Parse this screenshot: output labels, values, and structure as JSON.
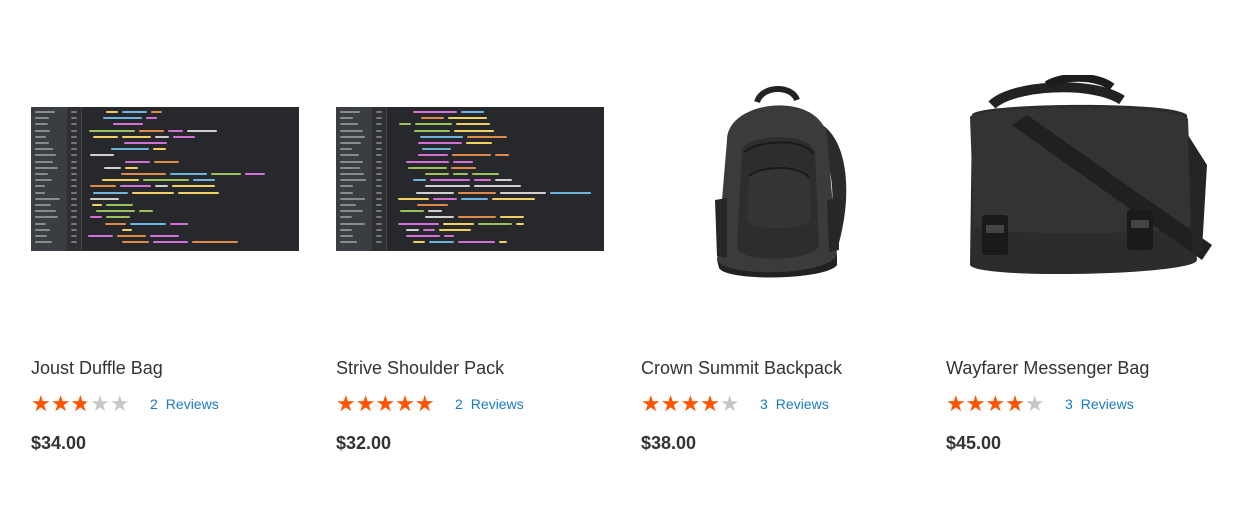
{
  "products": [
    {
      "name": "Joust Duffle Bag",
      "image": "code-editor-screenshot",
      "rating_fraction": 0.5,
      "reviews_count": "2",
      "reviews_label": "Reviews",
      "price": "$34.00"
    },
    {
      "name": "Strive Shoulder Pack",
      "image": "code-editor-screenshot",
      "rating_fraction": 0.9,
      "reviews_count": "2",
      "reviews_label": "Reviews",
      "price": "$32.00"
    },
    {
      "name": "Crown Summit Backpack",
      "image": "black-backpack",
      "rating_fraction": 0.73,
      "reviews_count": "3",
      "reviews_label": "Reviews",
      "price": "$38.00"
    },
    {
      "name": "Wayfarer Messenger Bag",
      "image": "black-messenger-bag",
      "rating_fraction": 0.73,
      "reviews_count": "3",
      "reviews_label": "Reviews",
      "price": "$45.00"
    }
  ],
  "colors": {
    "star_filled": "#ff5501",
    "star_empty": "#c7c7c7",
    "link": "#1979c3",
    "text": "#333333"
  }
}
